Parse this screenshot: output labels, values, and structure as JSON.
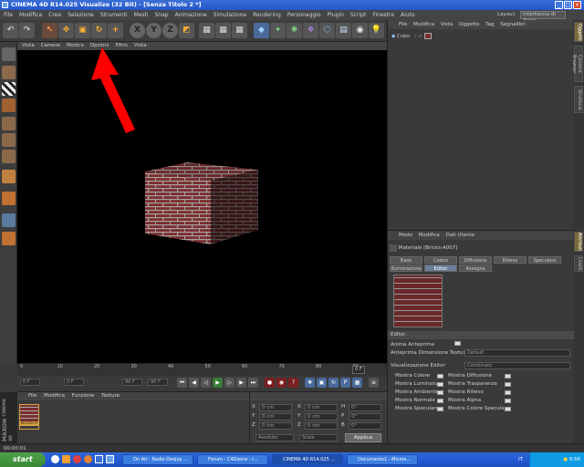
{
  "window": {
    "title": "CINEMA 4D R14.025 Visualize (32 Bit) - [Senza Titolo 2 *]",
    "controls": [
      "_",
      "□",
      "×"
    ]
  },
  "menubar": {
    "items": [
      "File",
      "Modifica",
      "Crea",
      "Selezione",
      "Strumenti",
      "Mesh",
      "Snap",
      "Animazione",
      "Simulazione",
      "Rendering",
      "Personaggio",
      "Plugin",
      "Script",
      "Finestre",
      "Aiuto"
    ],
    "layout_label": "Layout:",
    "layout_value": "Interfaccia di Avvio"
  },
  "viewport_menu": {
    "items": [
      "Vista",
      "Camere",
      "Mostra",
      "Opzioni",
      "Filtro",
      "Vista"
    ]
  },
  "timeline": {
    "ticks": [
      "0",
      "10",
      "20",
      "30",
      "40",
      "50",
      "60",
      "70",
      "80",
      "90"
    ],
    "current_frame": "0 F"
  },
  "playbar": {
    "start": "0 F",
    "min": "0 F",
    "end": "90 F",
    "max": "90 F"
  },
  "material_manager": {
    "menu": [
      "File",
      "Modifica",
      "Funzione",
      "Texture"
    ],
    "material_name": "Bricks-A"
  },
  "coordinates": {
    "rows": [
      {
        "axis": "X",
        "pos": "0 cm",
        "axis2": "X",
        "size": "0 cm",
        "axis3": "H",
        "rot": "0°"
      },
      {
        "axis": "Y",
        "pos": "0 cm",
        "axis2": "Y",
        "size": "0 cm",
        "axis3": "P",
        "rot": "0°"
      },
      {
        "axis": "Z",
        "pos": "0 cm",
        "axis2": "Z",
        "size": "0 cm",
        "axis3": "B",
        "rot": "0°"
      }
    ],
    "mode1": "Assoluto",
    "mode2": "Scala",
    "apply": "Applica"
  },
  "object_manager": {
    "menu": [
      "File",
      "Modifica",
      "Vista",
      "Oggetto",
      "Tag",
      "Segnalibri"
    ],
    "objects": [
      {
        "name": "Cubo"
      }
    ]
  },
  "attributes": {
    "menu": [
      "Modo",
      "Modifica",
      "Dati Utente"
    ],
    "material_title": "Materiale [Bricks-A007]",
    "tabs_row1": [
      "Base",
      "Colore",
      "Diffusione",
      "Rilievo",
      "Speculare"
    ],
    "tabs_row2": [
      "Illuminazione",
      "Editor",
      "Assegna"
    ],
    "section": "Editor",
    "props": [
      {
        "label": "Anima Anteprima",
        "value": ""
      },
      {
        "label": "Anteprima Dimensione Texture",
        "value": "Default"
      },
      {
        "label": "Visualizzazione Editor",
        "value": "Combinato"
      }
    ],
    "checks_left": [
      "Mostra Colore",
      "Mostra Luminanza",
      "Mostra Ambiente",
      "Mostra Normale",
      "Mostra Speculare"
    ],
    "checks_right": [
      "Mostra Diffusione",
      "Mostra Trasparenza",
      "Mostra Rilievo",
      "Mostra Alpha",
      "Mostra Colore Speculare"
    ]
  },
  "right_tabs": [
    "Oggetti",
    "Content Browser",
    "Struttura"
  ],
  "right_tabs_lower": [
    "Attributi",
    "Livelli"
  ],
  "status": {
    "time": "00:00:01"
  },
  "maxon": {
    "brand": "MAXON",
    "product": "CINEMA 4D"
  },
  "taskbar": {
    "start": "start",
    "tasks": [
      {
        "label": "On Air - Radio Deejay ...",
        "active": false
      },
      {
        "label": "Forum - C4Dzone - I...",
        "active": false
      },
      {
        "label": "CINEMA 4D R14.025 ...",
        "active": true
      },
      {
        "label": "Documento1 - Micros...",
        "active": false
      }
    ],
    "lang": "IT",
    "clock": "9.56"
  },
  "colors": {
    "accent_red": "#ff0000",
    "title_blue": "#2456c9",
    "taskbar_blue": "#245dd7",
    "start_green": "#3a8a35",
    "brick": "#8a3a3a"
  }
}
